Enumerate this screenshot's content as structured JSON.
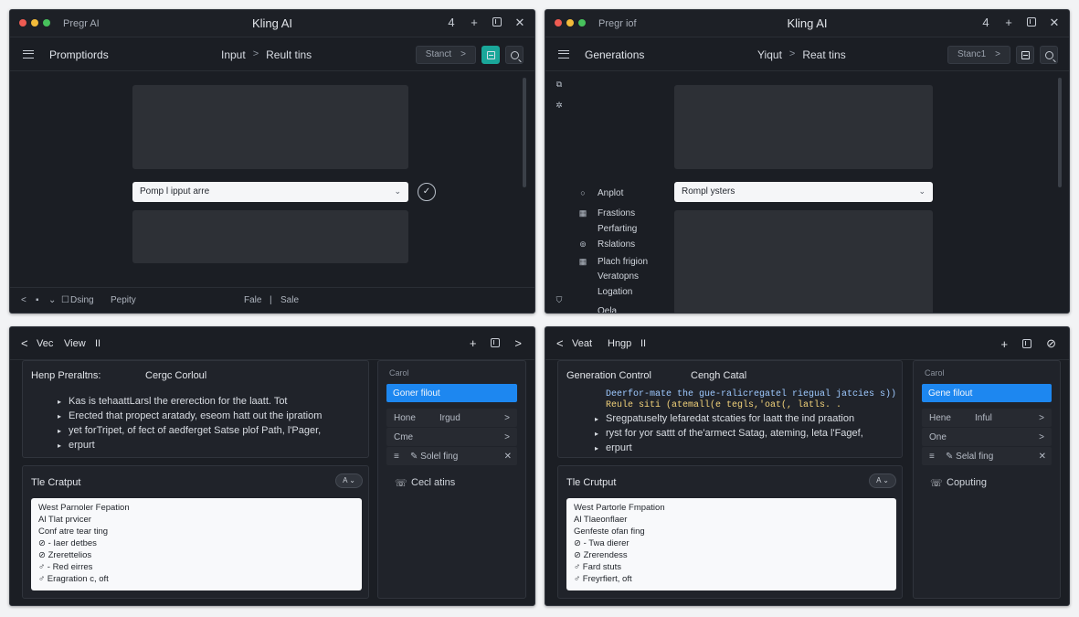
{
  "colors": {
    "accent_blue": "#1d87f0",
    "accent_teal": "#1aa79a",
    "window_bg": "#1b1e24"
  },
  "w1": {
    "tab": "Pregr AI",
    "title": "Kling AI",
    "controls": [
      "4",
      "+"
    ],
    "nav_title": "Promptiords",
    "crumbs": [
      "Input",
      "Reult tins"
    ],
    "pill": "Stanct",
    "prompt_value": "Pomp l ipput arre",
    "footer": [
      "Dsing",
      "Pepity",
      "Fale",
      "|",
      "Sale"
    ]
  },
  "w2": {
    "tab": "Pregr iof",
    "title": "Kling AI",
    "controls": [
      "4",
      "+"
    ],
    "nav_title": "Generations",
    "crumbs": [
      "Yiqut",
      "Reat tins"
    ],
    "pill": "Stanc1",
    "prompt_value": "Rompl ysters",
    "menu": [
      "Anplot",
      "Frastions",
      "Perfarting",
      "Rslations",
      "Plach frigion",
      "Veratopns",
      "Logation",
      "Oela"
    ]
  },
  "w3": {
    "back_label": "Vec",
    "view_label": "View",
    "pause_label": "II",
    "top_right": [
      "+",
      ">"
    ],
    "panel1_title_a": "Henp Preraltns:",
    "panel1_title_b": "Cergc Corloul",
    "bullets": [
      "Kas is tehaattLarsl the ererection for the laatt. Tot",
      "Erected that propect aratady, eseom hatt out the ipratiom",
      "yet forTripet, of fect of aedferget Satse plof Path, l'Pager,",
      "erpurt"
    ],
    "panel2_title": "Tle Cratput",
    "panel2_dropdown": "A ⌄",
    "output_lines": [
      "West Parnoler Fepation",
      "Al Tlat prvicer",
      "Conf atre tear ting",
      "⊘  - Iaer detbes",
      "⊘  Zrerettelios",
      "♂  - Red eirres",
      "♂  Eragration c, oft"
    ],
    "rpanel_label": "Carol",
    "rpanel_button": "Goner filout",
    "rpanel_items": [
      {
        "a": "Hone",
        "b": "Irgud",
        "c": ">"
      },
      {
        "a": "Cme",
        "b": "",
        "c": ">"
      },
      {
        "a": "≡",
        "b": "✎ Solel fing",
        "c": "✕"
      }
    ],
    "rpanel_link": "Cecl atins",
    "rpanel_link_icon": "☏"
  },
  "w4": {
    "back_label": "Veat",
    "view_label": "Hngp",
    "pause_label": "II",
    "top_right": [
      "+",
      "⊘"
    ],
    "panel1_title_a": "Generation Control",
    "panel1_title_b": "Cengh Catal",
    "code_lines": [
      "Deerfor-mate the gue-ralicregatel riegual jatcies s))",
      "Reule siti (atemall(e tegls,'oat(, latls.  ."
    ],
    "bullets": [
      "Sregpatuselty lefaredat stcaties for laatt the ind praation",
      "ryst for yor sattt  of the'armect Satag, ateming, leta l'Fagef,",
      "erpurt"
    ],
    "panel2_title": "Tle Crutput",
    "panel2_dropdown": "A ⌄",
    "output_lines": [
      "West Partorle Fmpation",
      "Al Tlaeonflaer",
      "Genfeste ofan fing",
      "⊘  - Twa dierer",
      "⊘  Zrerendess",
      "♂  Fard stuts",
      "♂  Freyrfiert, oft"
    ],
    "rpanel_label": "Carol",
    "rpanel_button": "Gene filout",
    "rpanel_items": [
      {
        "a": "Hene",
        "b": "Inful",
        "c": ">"
      },
      {
        "a": "One",
        "b": "",
        "c": ">"
      },
      {
        "a": "≡",
        "b": "✎ Selal fing",
        "c": "✕"
      }
    ],
    "rpanel_link": "Coputing",
    "rpanel_link_icon": "☏"
  }
}
